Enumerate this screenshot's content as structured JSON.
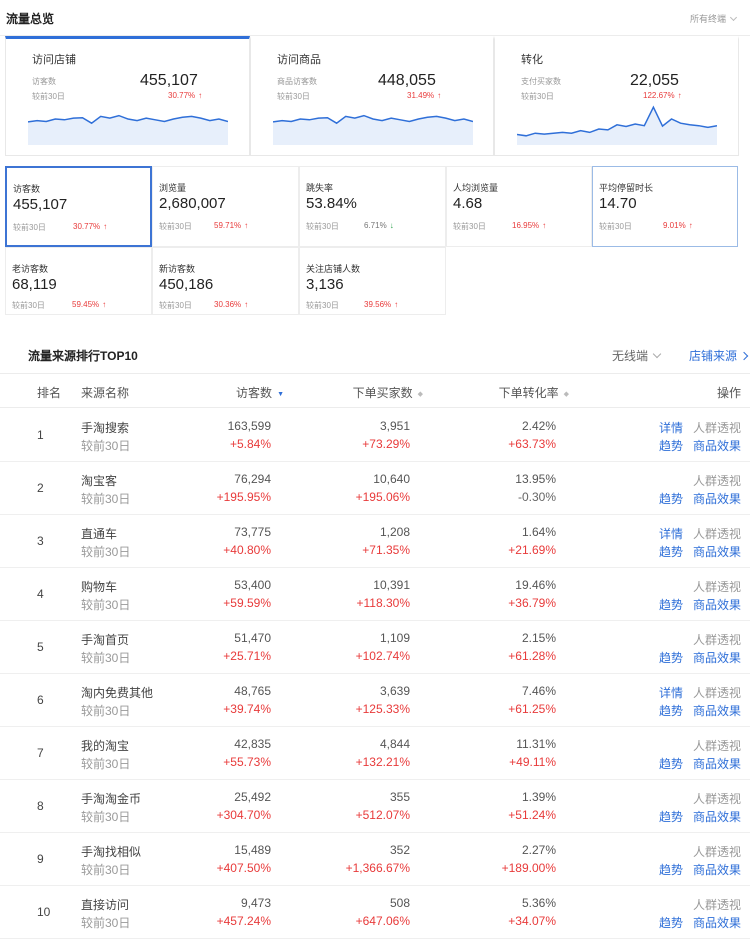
{
  "overview": {
    "title": "流量总览",
    "filter": "所有终端",
    "compare_label": "较前30日",
    "cards": [
      {
        "title": "访问店铺",
        "metric": "访客数",
        "value": "455,107",
        "pct": "30.77%",
        "trend": [
          0.45,
          0.42,
          0.44,
          0.38,
          0.4,
          0.36,
          0.35,
          0.48,
          0.32,
          0.36,
          0.3,
          0.38,
          0.42,
          0.36,
          0.4,
          0.44,
          0.38,
          0.34,
          0.32,
          0.36,
          0.42,
          0.38,
          0.44
        ]
      },
      {
        "title": "访问商品",
        "metric": "商品访客数",
        "value": "448,055",
        "pct": "31.49%",
        "trend": [
          0.45,
          0.42,
          0.44,
          0.38,
          0.4,
          0.36,
          0.35,
          0.48,
          0.32,
          0.36,
          0.3,
          0.38,
          0.42,
          0.36,
          0.4,
          0.44,
          0.38,
          0.34,
          0.32,
          0.36,
          0.42,
          0.38,
          0.44
        ]
      },
      {
        "title": "转化",
        "metric": "支付买家数",
        "value": "22,055",
        "pct": "122.67%",
        "trend": [
          0.75,
          0.78,
          0.72,
          0.74,
          0.72,
          0.7,
          0.72,
          0.66,
          0.7,
          0.62,
          0.64,
          0.52,
          0.56,
          0.5,
          0.54,
          0.1,
          0.55,
          0.38,
          0.48,
          0.52,
          0.54,
          0.58,
          0.54
        ]
      }
    ]
  },
  "metrics": [
    {
      "label": "访客数",
      "value": "455,107",
      "pct": "30.77%",
      "dir": "up"
    },
    {
      "label": "浏览量",
      "value": "2,680,007",
      "pct": "59.71%",
      "dir": "up"
    },
    {
      "label": "跳失率",
      "value": "53.84%",
      "pct": "6.71%",
      "dir": "down"
    },
    {
      "label": "人均浏览量",
      "value": "4.68",
      "pct": "16.95%",
      "dir": "up"
    },
    {
      "label": "平均停留时长",
      "value": "14.70",
      "pct": "9.01%",
      "dir": "up"
    },
    {
      "label": "老访客数",
      "value": "68,119",
      "pct": "59.45%",
      "dir": "up"
    },
    {
      "label": "新访客数",
      "value": "450,186",
      "pct": "30.36%",
      "dir": "up"
    },
    {
      "label": "关注店铺人数",
      "value": "3,136",
      "pct": "39.56%",
      "dir": "up"
    }
  ],
  "top10": {
    "title": "流量来源排行TOP10",
    "device": "无线端",
    "link": "店铺来源",
    "columns": {
      "rank": "排名",
      "name": "来源名称",
      "visitors": "访客数",
      "buyers": "下单买家数",
      "conversion": "下单转化率",
      "ops": "操作"
    },
    "compare_label": "较前30日",
    "ops_labels": {
      "detail": "详情",
      "trend": "趋势",
      "crowd": "人群透视",
      "goods": "商品效果"
    },
    "rows": [
      {
        "rank": "1",
        "name": "手淘搜索",
        "v": "163,599",
        "vp": "+5.84%",
        "b": "3,951",
        "bp": "+73.29%",
        "c": "2.42%",
        "cp": "+63.73%",
        "detail": true
      },
      {
        "rank": "2",
        "name": "淘宝客",
        "v": "76,294",
        "vp": "+195.95%",
        "b": "10,640",
        "bp": "+195.06%",
        "c": "13.95%",
        "cp": "-0.30%",
        "detail": false
      },
      {
        "rank": "3",
        "name": "直通车",
        "v": "73,775",
        "vp": "+40.80%",
        "b": "1,208",
        "bp": "+71.35%",
        "c": "1.64%",
        "cp": "+21.69%",
        "detail": true
      },
      {
        "rank": "4",
        "name": "购物车",
        "v": "53,400",
        "vp": "+59.59%",
        "b": "10,391",
        "bp": "+118.30%",
        "c": "19.46%",
        "cp": "+36.79%",
        "detail": false
      },
      {
        "rank": "5",
        "name": "手淘首页",
        "v": "51,470",
        "vp": "+25.71%",
        "b": "1,109",
        "bp": "+102.74%",
        "c": "2.15%",
        "cp": "+61.28%",
        "detail": false
      },
      {
        "rank": "6",
        "name": "淘内免费其他",
        "v": "48,765",
        "vp": "+39.74%",
        "b": "3,639",
        "bp": "+125.33%",
        "c": "7.46%",
        "cp": "+61.25%",
        "detail": true
      },
      {
        "rank": "7",
        "name": "我的淘宝",
        "v": "42,835",
        "vp": "+55.73%",
        "b": "4,844",
        "bp": "+132.21%",
        "c": "11.31%",
        "cp": "+49.11%",
        "detail": false
      },
      {
        "rank": "8",
        "name": "手淘淘金币",
        "v": "25,492",
        "vp": "+304.70%",
        "b": "355",
        "bp": "+512.07%",
        "c": "1.39%",
        "cp": "+51.24%",
        "detail": false
      },
      {
        "rank": "9",
        "name": "手淘找相似",
        "v": "15,489",
        "vp": "+407.50%",
        "b": "352",
        "bp": "+1,366.67%",
        "c": "2.27%",
        "cp": "+189.00%",
        "detail": false
      },
      {
        "rank": "10",
        "name": "直接访问",
        "v": "9,473",
        "vp": "+457.24%",
        "b": "508",
        "bp": "+647.06%",
        "c": "5.36%",
        "cp": "+34.07%",
        "detail": false
      }
    ]
  },
  "colors": {
    "accent": "#2f6fd8",
    "up": "#e83a3a",
    "down": "#2aa14b"
  }
}
